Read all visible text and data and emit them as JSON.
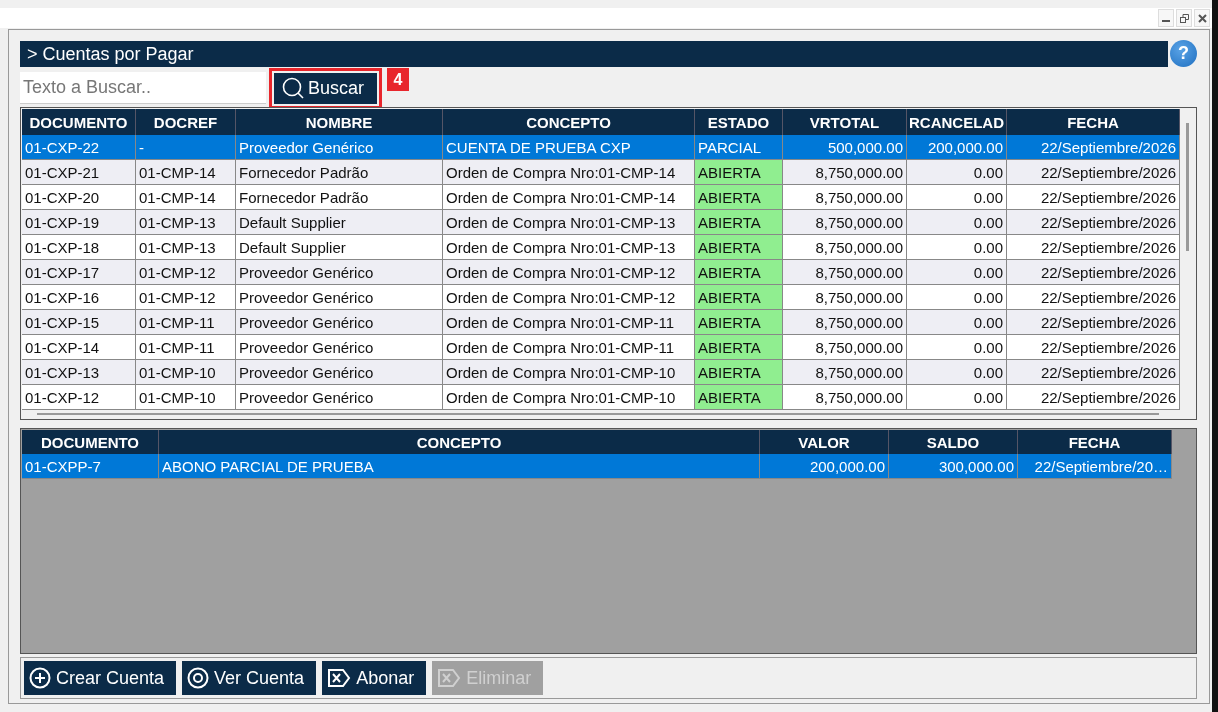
{
  "header": {
    "title": "> Cuentas por Pagar",
    "help": "?"
  },
  "search": {
    "placeholder": "Texto a Buscar..",
    "button": "Buscar",
    "badge": "4"
  },
  "accounts": {
    "columns": [
      "DOCUMENTO",
      "DOCREF",
      "NOMBRE",
      "CONCEPTO",
      "ESTADO",
      "VRTOTAL",
      "RCANCELAD",
      "FECHA"
    ],
    "rows": [
      {
        "selected": true,
        "cells": [
          "01-CXP-22",
          "-",
          "Proveedor Genérico",
          "CUENTA DE PRUEBA CXP",
          "PARCIAL",
          "500,000.00",
          "200,000.00",
          "22/Septiembre/2026"
        ]
      },
      {
        "selected": false,
        "color": "#90ee90",
        "cells": [
          "01-CXP-21",
          "01-CMP-14",
          "Fornecedor Padrão",
          "Orden de Compra Nro:01-CMP-14",
          "ABIERTA",
          "8,750,000.00",
          "0.00",
          "22/Septiembre/2026"
        ]
      },
      {
        "selected": false,
        "color": "#90ee90",
        "cells": [
          "01-CXP-20",
          "01-CMP-14",
          "Fornecedor Padrão",
          "Orden de Compra Nro:01-CMP-14",
          "ABIERTA",
          "8,750,000.00",
          "0.00",
          "22/Septiembre/2026"
        ]
      },
      {
        "selected": false,
        "color": "#90ee90",
        "cells": [
          "01-CXP-19",
          "01-CMP-13",
          "Default Supplier",
          "Orden de Compra Nro:01-CMP-13",
          "ABIERTA",
          "8,750,000.00",
          "0.00",
          "22/Septiembre/2026"
        ]
      },
      {
        "selected": false,
        "color": "#90ee90",
        "cells": [
          "01-CXP-18",
          "01-CMP-13",
          "Default Supplier",
          "Orden de Compra Nro:01-CMP-13",
          "ABIERTA",
          "8,750,000.00",
          "0.00",
          "22/Septiembre/2026"
        ]
      },
      {
        "selected": false,
        "color": "#90ee90",
        "cells": [
          "01-CXP-17",
          "01-CMP-12",
          "Proveedor Genérico",
          "Orden de Compra Nro:01-CMP-12",
          "ABIERTA",
          "8,750,000.00",
          "0.00",
          "22/Septiembre/2026"
        ]
      },
      {
        "selected": false,
        "color": "#90ee90",
        "cells": [
          "01-CXP-16",
          "01-CMP-12",
          "Proveedor Genérico",
          "Orden de Compra Nro:01-CMP-12",
          "ABIERTA",
          "8,750,000.00",
          "0.00",
          "22/Septiembre/2026"
        ]
      },
      {
        "selected": false,
        "color": "#90ee90",
        "cells": [
          "01-CXP-15",
          "01-CMP-11",
          "Proveedor Genérico",
          "Orden de Compra Nro:01-CMP-11",
          "ABIERTA",
          "8,750,000.00",
          "0.00",
          "22/Septiembre/2026"
        ]
      },
      {
        "selected": false,
        "color": "#90ee90",
        "cells": [
          "01-CXP-14",
          "01-CMP-11",
          "Proveedor Genérico",
          "Orden de Compra Nro:01-CMP-11",
          "ABIERTA",
          "8,750,000.00",
          "0.00",
          "22/Septiembre/2026"
        ]
      },
      {
        "selected": false,
        "color": "#90ee90",
        "cells": [
          "01-CXP-13",
          "01-CMP-10",
          "Proveedor Genérico",
          "Orden de Compra Nro:01-CMP-10",
          "ABIERTA",
          "8,750,000.00",
          "0.00",
          "22/Septiembre/2026"
        ]
      },
      {
        "selected": false,
        "color": "#90ee90",
        "cells": [
          "01-CXP-12",
          "01-CMP-10",
          "Proveedor Genérico",
          "Orden de Compra Nro:01-CMP-10",
          "ABIERTA",
          "8,750,000.00",
          "0.00",
          "22/Septiembre/2026"
        ]
      }
    ]
  },
  "payments": {
    "columns": [
      "DOCUMENTO",
      "CONCEPTO",
      "VALOR",
      "SALDO",
      "FECHA"
    ],
    "rows": [
      {
        "selected": true,
        "cells": [
          "01-CXPP-7",
          "ABONO PARCIAL DE PRUEBA",
          "200,000.00",
          "300,000.00",
          "22/Septiembre/20…"
        ]
      }
    ]
  },
  "buttons": [
    {
      "kind": "plus",
      "label": "Crear Cuenta",
      "disabled": false
    },
    {
      "kind": "eye",
      "label": "Ver Cuenta",
      "disabled": false
    },
    {
      "kind": "x",
      "label": "Abonar",
      "disabled": false
    },
    {
      "kind": "x",
      "label": "Eliminar",
      "disabled": true
    }
  ]
}
